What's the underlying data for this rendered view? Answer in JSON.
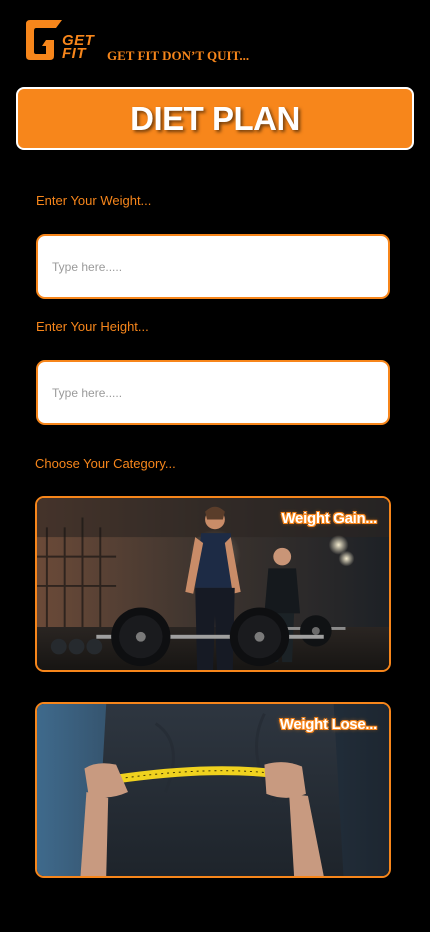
{
  "header": {
    "logo_line1": "GET",
    "logo_line2": "FIT",
    "tagline": "GET FIT DON’T QUIT...",
    "brand_color": "#f7861b"
  },
  "title_bar": {
    "title": "DIET PLAN"
  },
  "form": {
    "weight_label": "Enter Your Weight...",
    "weight_placeholder": "Type here.....",
    "height_label": "Enter Your Height...",
    "height_placeholder": "Type here.....",
    "category_label": "Choose Your Category..."
  },
  "categories": [
    {
      "label": "Weight Gain...",
      "photo": "gym-barbell-deadlift-photo"
    },
    {
      "label": "Weight Lose...",
      "photo": "measuring-tape-waist-photo"
    }
  ]
}
